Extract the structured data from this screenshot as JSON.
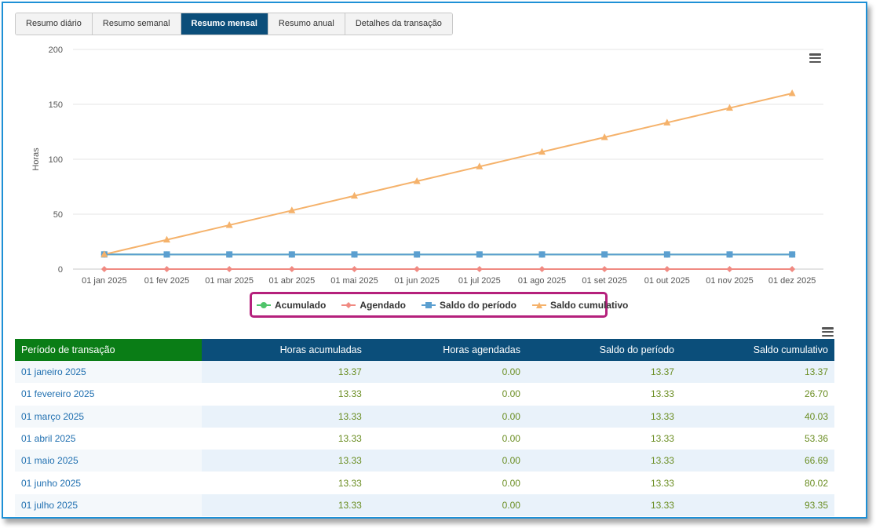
{
  "tabs": [
    {
      "label": "Resumo diário",
      "active": false
    },
    {
      "label": "Resumo semanal",
      "active": false
    },
    {
      "label": "Resumo mensal",
      "active": true
    },
    {
      "label": "Resumo anual",
      "active": false
    },
    {
      "label": "Detalhes da transação",
      "active": false
    }
  ],
  "chart_data": {
    "type": "line",
    "ylabel": "Horas",
    "ylim": [
      0,
      200
    ],
    "yticks": [
      "0",
      "50",
      "100",
      "150",
      "200"
    ],
    "grid": true,
    "legend_placement": "bottom-center",
    "categories": [
      "01 jan 2025",
      "01 fev 2025",
      "01 mar 2025",
      "01 abr 2025",
      "01 mai 2025",
      "01 jun 2025",
      "01 jul 2025",
      "01 ago 2025",
      "01 set 2025",
      "01 out 2025",
      "01 nov 2025",
      "01 dez 2025"
    ],
    "series": [
      {
        "name": "Acumulado",
        "color": "#4fc46a",
        "marker": "circle",
        "values": [
          13.37,
          13.33,
          13.33,
          13.33,
          13.33,
          13.33,
          13.33,
          13.33,
          13.33,
          13.33,
          13.33,
          13.33
        ]
      },
      {
        "name": "Agendado",
        "color": "#f08a82",
        "marker": "diamond",
        "values": [
          0,
          0,
          0,
          0,
          0,
          0,
          0,
          0,
          0,
          0,
          0,
          0
        ]
      },
      {
        "name": "Saldo do período",
        "color": "#5b9fd0",
        "marker": "square",
        "values": [
          13.37,
          13.33,
          13.33,
          13.33,
          13.33,
          13.33,
          13.33,
          13.33,
          13.33,
          13.33,
          13.33,
          13.33
        ]
      },
      {
        "name": "Saldo cumulativo",
        "color": "#f5b26b",
        "marker": "triangle",
        "values": [
          13.37,
          26.7,
          40.03,
          53.36,
          66.69,
          80.02,
          93.35,
          106.68,
          120.01,
          133.34,
          146.67,
          160.0
        ]
      }
    ]
  },
  "table": {
    "headers": [
      "Período de transação",
      "Horas acumuladas",
      "Horas agendadas",
      "Saldo do período",
      "Saldo cumulativo"
    ],
    "rows": [
      [
        "01 janeiro 2025",
        "13.37",
        "0.00",
        "13.37",
        "13.37"
      ],
      [
        "01 fevereiro 2025",
        "13.33",
        "0.00",
        "13.33",
        "26.70"
      ],
      [
        "01 março 2025",
        "13.33",
        "0.00",
        "13.33",
        "40.03"
      ],
      [
        "01 abril 2025",
        "13.33",
        "0.00",
        "13.33",
        "53.36"
      ],
      [
        "01 maio 2025",
        "13.33",
        "0.00",
        "13.33",
        "66.69"
      ],
      [
        "01 junho 2025",
        "13.33",
        "0.00",
        "13.33",
        "80.02"
      ],
      [
        "01 julho 2025",
        "13.33",
        "0.00",
        "13.33",
        "93.35"
      ]
    ]
  },
  "icons": {
    "chart_menu": "hamburger-menu-icon",
    "table_menu": "hamburger-menu-icon"
  }
}
